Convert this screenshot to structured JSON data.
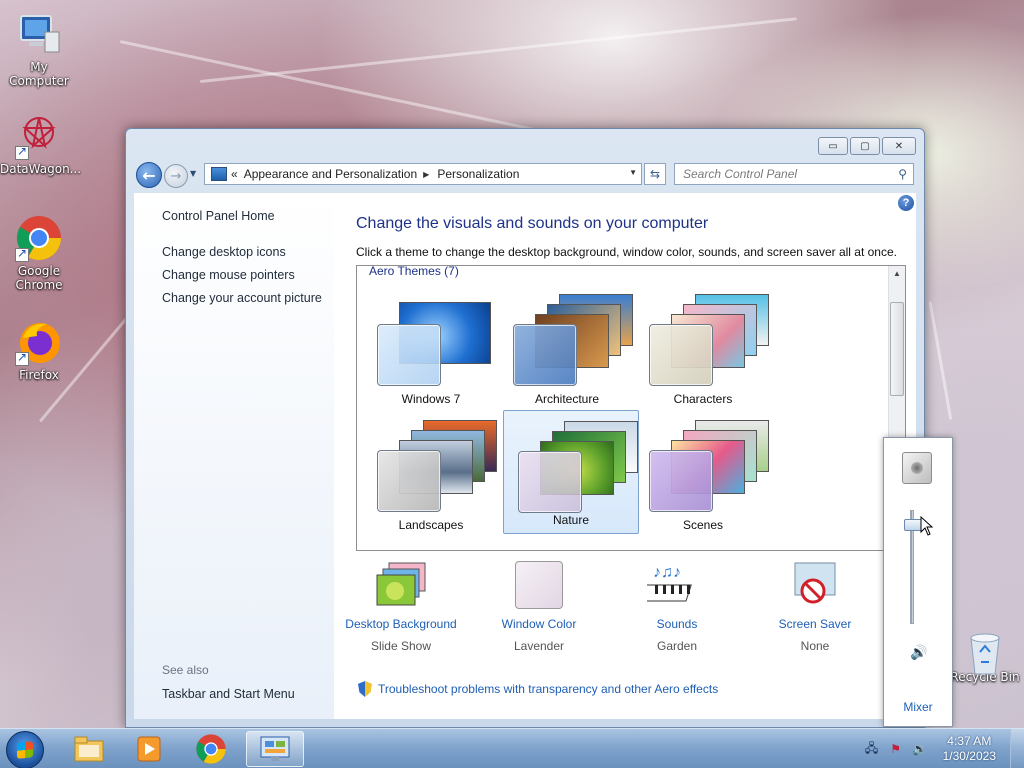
{
  "desktop": {
    "icons": [
      {
        "label": "My Computer"
      },
      {
        "label": "DataWagon..."
      },
      {
        "label": "Google Chrome"
      },
      {
        "label": "Firefox"
      },
      {
        "label": "Recycle Bin"
      }
    ]
  },
  "window": {
    "controls": {
      "minimize": "▭",
      "maximize": "▢",
      "close": "✕"
    },
    "address": {
      "overflow": "«",
      "segments": [
        "Appearance and Personalization",
        "Personalization"
      ],
      "separator": "▶"
    },
    "search": {
      "placeholder": "Search Control Panel"
    },
    "left_pane": {
      "home": "Control Panel Home",
      "links": [
        "Change desktop icons",
        "Change mouse pointers",
        "Change your account picture"
      ],
      "see_also_label": "See also",
      "see_also_links": [
        "Taskbar and Start Menu"
      ]
    },
    "content": {
      "title": "Change the visuals and sounds on your computer",
      "description": "Click a theme to change the desktop background, window color, sounds, and screen saver all at once.",
      "group_label": "Aero Themes (7)",
      "themes": [
        {
          "name": "Windows 7",
          "selected": false
        },
        {
          "name": "Architecture",
          "selected": false
        },
        {
          "name": "Characters",
          "selected": false
        },
        {
          "name": "Landscapes",
          "selected": false
        },
        {
          "name": "Nature",
          "selected": true
        },
        {
          "name": "Scenes",
          "selected": false
        }
      ],
      "options": [
        {
          "title": "Desktop Background",
          "value": "Slide Show"
        },
        {
          "title": "Window Color",
          "value": "Lavender"
        },
        {
          "title": "Sounds",
          "value": "Garden"
        },
        {
          "title": "Screen Saver",
          "value": "None"
        }
      ],
      "troubleshoot": "Troubleshoot problems with transparency and other Aero effects"
    }
  },
  "volume_flyout": {
    "mixer_label": "Mixer",
    "level": 0.87
  },
  "taskbar": {
    "time": "4:37 AM",
    "date": "1/30/2023"
  },
  "colors": {
    "link": "#1e5fb5",
    "heading": "#1e3287",
    "selection": "#d7e8fb"
  }
}
